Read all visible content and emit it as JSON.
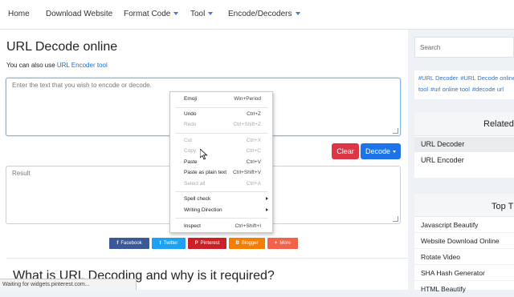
{
  "nav": {
    "items": [
      {
        "label": "Home",
        "has_caret": false
      },
      {
        "label": "Download Website",
        "has_caret": false
      },
      {
        "label": "Format Code",
        "has_caret": true
      },
      {
        "label": "Tool",
        "has_caret": true
      },
      {
        "label": "Encode/Decoders",
        "has_caret": true
      }
    ]
  },
  "main": {
    "title": "URL Decode online",
    "also_prefix": "You can also use",
    "also_link": "URL Encoder tool",
    "input_placeholder": "Enter the text that you wish to encode or decode.",
    "clear_label": "Clear",
    "decode_label": "Decode",
    "result_label": "Result",
    "section_heading": "What is URL Decoding and why is it required?"
  },
  "share": [
    {
      "label": "Facebook",
      "icon": "f",
      "color": "#3b5998"
    },
    {
      "label": "Twitter",
      "icon": "t",
      "color": "#1da1f2"
    },
    {
      "label": "Pinterest",
      "icon": "P",
      "color": "#cb2027"
    },
    {
      "label": "Blogger",
      "icon": "B",
      "color": "#f57d00"
    },
    {
      "label": "More",
      "icon": "+",
      "color": "#f0624a"
    }
  ],
  "sidebar": {
    "search_placeholder": "Search",
    "tags": [
      "#URL Decoder",
      "#URL Decode online",
      "tool",
      "#url online tool",
      "#decode url"
    ],
    "related_title": "Related",
    "related_items": [
      "URL Decoder",
      "URL Encoder"
    ],
    "top_title": "Top T",
    "top_items": [
      "Javascript Beautify",
      "Website Download Online",
      "Rotate Video",
      "SHA Hash Generator",
      "HTML Beautify"
    ]
  },
  "context_menu": {
    "groups": [
      [
        {
          "label": "Emoji",
          "shortcut": "Win+Period",
          "disabled": false
        }
      ],
      [
        {
          "label": "Undo",
          "shortcut": "Ctrl+Z",
          "disabled": false
        },
        {
          "label": "Redo",
          "shortcut": "Ctrl+Shift+Z",
          "disabled": true
        }
      ],
      [
        {
          "label": "Cut",
          "shortcut": "Ctrl+X",
          "disabled": true
        },
        {
          "label": "Copy",
          "shortcut": "Ctrl+C",
          "disabled": true
        },
        {
          "label": "Paste",
          "shortcut": "Ctrl+V",
          "disabled": false
        },
        {
          "label": "Paste as plain text",
          "shortcut": "Ctrl+Shift+V",
          "disabled": false
        },
        {
          "label": "Select all",
          "shortcut": "Ctrl+A",
          "disabled": true
        }
      ],
      [
        {
          "label": "Spell check",
          "shortcut": "",
          "submenu": true,
          "disabled": false
        },
        {
          "label": "Writing Direction",
          "shortcut": "",
          "submenu": true,
          "disabled": false
        }
      ],
      [
        {
          "label": "Inspect",
          "shortcut": "Ctrl+Shift+I",
          "disabled": false
        }
      ]
    ]
  },
  "status_bar": "Waiting for widgets.pinterest.com...",
  "colors": {
    "accent": "#1d74e8",
    "danger": "#dc3545",
    "link": "#1a6fc9",
    "tag": "#2f72c4"
  }
}
